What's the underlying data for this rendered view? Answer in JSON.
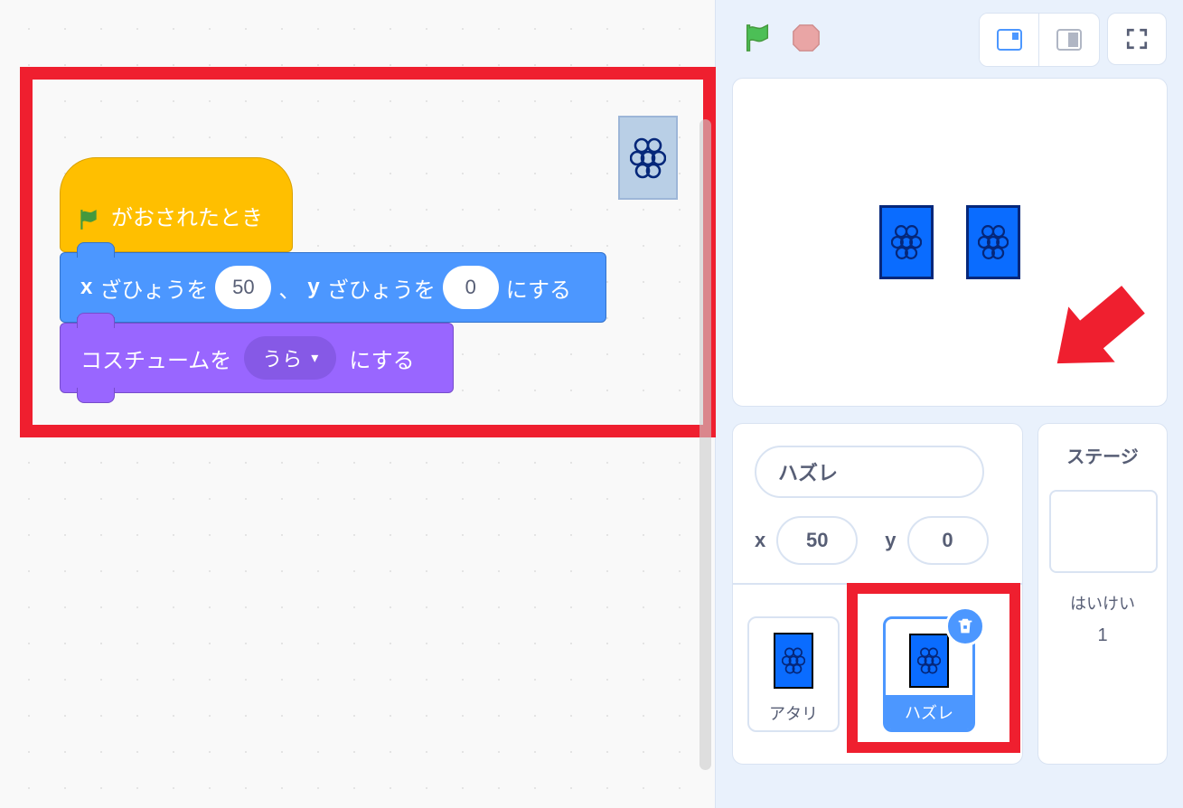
{
  "controls": {
    "flag_name": "green-flag",
    "stop_name": "stop"
  },
  "blocks": {
    "hat_label": "がおされたとき",
    "motion": {
      "x_prefix": "x",
      "coord_word": "ざひょうを",
      "x_value": "50",
      "comma": "、",
      "y_prefix": "y",
      "y_value": "0",
      "suffix": "にする"
    },
    "looks": {
      "prefix": "コスチュームを",
      "option": "うら",
      "suffix": "にする"
    }
  },
  "sprite_info": {
    "name": "ハズレ",
    "x_label": "x",
    "x_value": "50",
    "y_label": "y",
    "y_value": "0"
  },
  "sprites": {
    "items": [
      {
        "label": "アタリ"
      },
      {
        "label": "ハズレ"
      }
    ]
  },
  "stage": {
    "title": "ステージ",
    "bg_label": "はいけい",
    "bg_count": "1"
  }
}
